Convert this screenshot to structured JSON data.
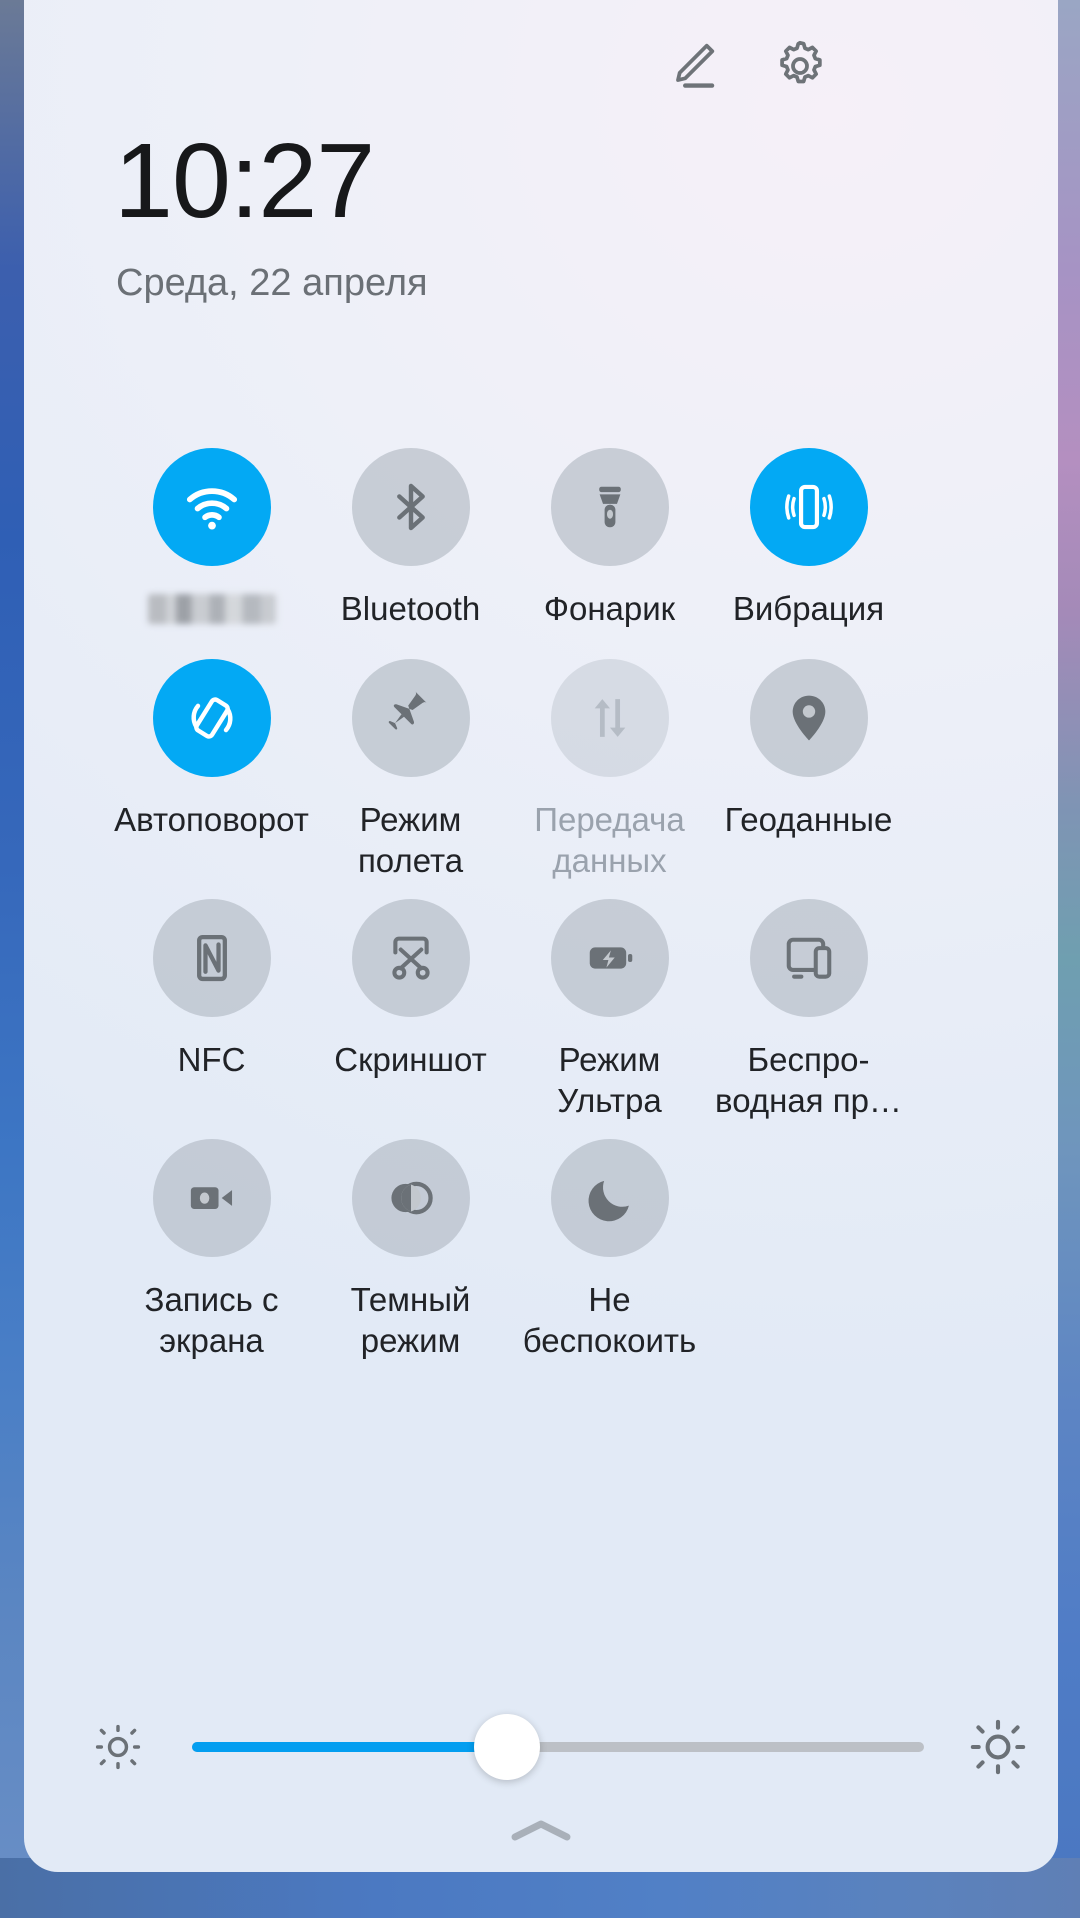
{
  "header": {
    "edit_icon": "pencil-edit-icon",
    "settings_icon": "gear-icon"
  },
  "clock": {
    "time": "10:27",
    "date": "Среда, 22 апреля"
  },
  "tiles": [
    [
      {
        "label": "",
        "icon": "wifi-icon",
        "state": "on",
        "name": "wifi",
        "label_blurred": true
      },
      {
        "label": "Bluetooth",
        "icon": "bluetooth-icon",
        "state": "off",
        "name": "bluetooth"
      },
      {
        "label": "Фонарик",
        "icon": "flashlight-icon",
        "state": "off",
        "name": "flashlight"
      },
      {
        "label": "Вибрация",
        "icon": "vibration-icon",
        "state": "on",
        "name": "vibration"
      }
    ],
    [
      {
        "label": "Автоповорот",
        "icon": "auto-rotate-icon",
        "state": "on",
        "name": "auto-rotate"
      },
      {
        "label": "Режим полета",
        "icon": "airplane-icon",
        "state": "off",
        "name": "airplane-mode"
      },
      {
        "label": "Передача данных",
        "icon": "data-transfer-icon",
        "state": "disabled",
        "name": "mobile-data"
      },
      {
        "label": "Геоданные",
        "icon": "location-pin-icon",
        "state": "off",
        "name": "location"
      }
    ],
    [
      {
        "label": "NFC",
        "icon": "nfc-icon",
        "state": "off",
        "name": "nfc"
      },
      {
        "label": "Скриншот",
        "icon": "scissors-icon",
        "state": "off",
        "name": "screenshot"
      },
      {
        "label": "Режим Ультра",
        "icon": "battery-bolt-icon",
        "state": "off",
        "name": "ultra-power-mode"
      },
      {
        "label": "Беспро-водная пр…",
        "icon": "cast-devices-icon",
        "state": "off",
        "name": "wireless-projection"
      }
    ],
    [
      {
        "label": "Запись с экрана",
        "icon": "camcorder-icon",
        "state": "off",
        "name": "screen-record"
      },
      {
        "label": "Темный режим",
        "icon": "dark-mode-icon",
        "state": "off",
        "name": "dark-mode"
      },
      {
        "label": "Не беспокоить",
        "icon": "moon-icon",
        "state": "off",
        "name": "do-not-disturb"
      }
    ]
  ],
  "brightness": {
    "value_percent": 43,
    "low_icon": "brightness-low-icon",
    "high_icon": "brightness-high-icon"
  },
  "footer": {
    "collapse_icon": "chevron-up-icon"
  },
  "colors": {
    "accent": "#03a9f4",
    "tile_off": "#b0b8c2",
    "text": "#212327",
    "text_dim": "#9aa2ad",
    "date_text": "#6b7076"
  }
}
